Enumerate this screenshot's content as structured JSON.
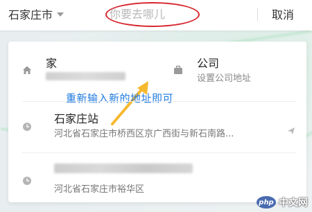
{
  "topbar": {
    "city": "石家庄市",
    "search_placeholder": "你要去哪儿",
    "cancel_label": "取消"
  },
  "quick_access": {
    "home": {
      "title": "家"
    },
    "work": {
      "title": "公司",
      "subtitle": "设置公司地址"
    }
  },
  "annotation": {
    "text": "重新输入新的地址即可",
    "color": "#1f7ae0",
    "arrow_color": "#f5b82e",
    "circle_color": "#d6242c"
  },
  "history": [
    {
      "title": "石家庄站",
      "subtitle": "河北省石家庄市桥西区京广西街与新石南路..."
    },
    {
      "title": "",
      "subtitle": "河北省石家庄市裕华区"
    }
  ],
  "watermark": {
    "logo_text": "php",
    "site_text": "中文网"
  }
}
